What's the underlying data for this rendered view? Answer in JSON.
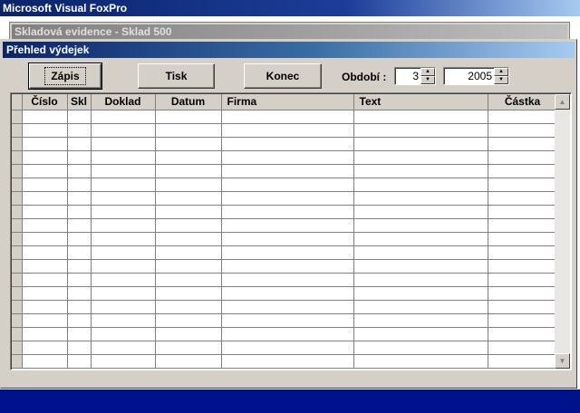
{
  "app": {
    "title": "Microsoft Visual FoxPro"
  },
  "bg_window": {
    "title": "Skladová evidence  - Sklad 500"
  },
  "dialog": {
    "title": "Přehled výdejek"
  },
  "toolbar": {
    "zapis_label": "Zápis",
    "tisk_label": "Tisk",
    "konec_label": "Konec",
    "period_label": "Období :",
    "month_value": "3",
    "year_value": "2005"
  },
  "grid": {
    "columns": [
      "Číslo",
      "Skl",
      "Doklad",
      "Datum",
      "Firma",
      "Text",
      "Částka"
    ],
    "row_count": 19
  },
  "icons": {
    "spin_up": "up-arrow-icon",
    "spin_down": "down-arrow-icon",
    "scroll_up": "scroll-up-icon",
    "scroll_down": "scroll-down-icon"
  }
}
